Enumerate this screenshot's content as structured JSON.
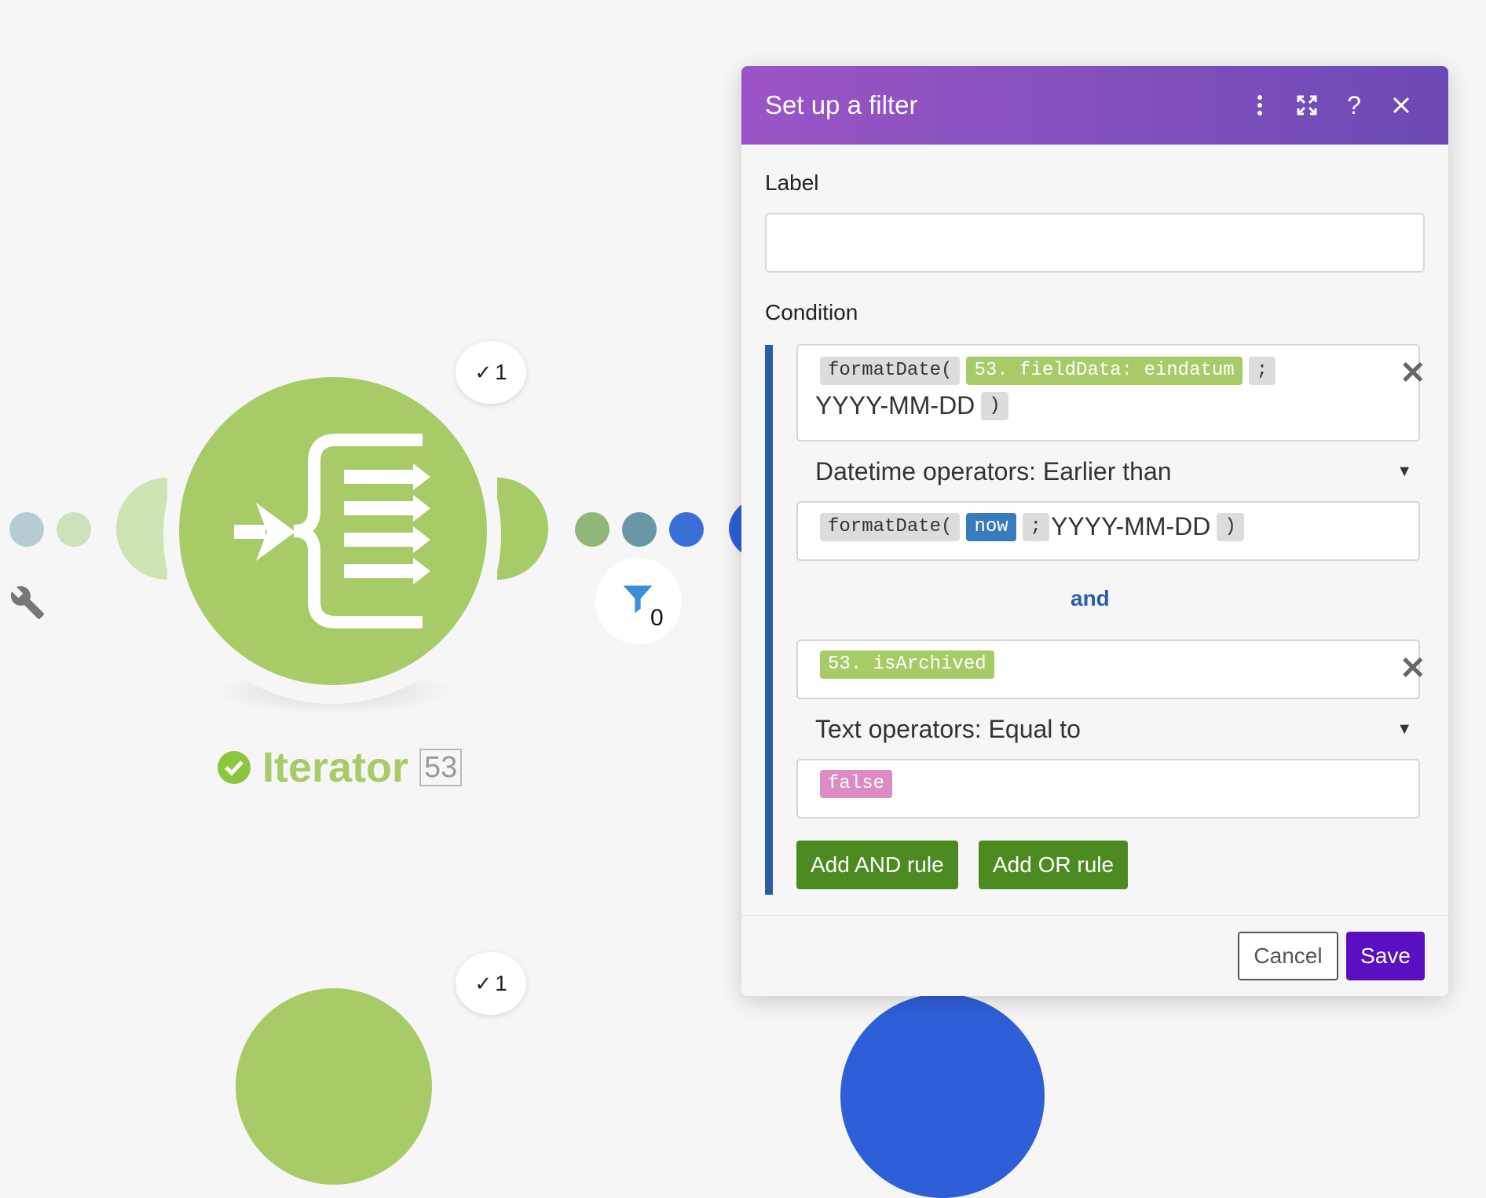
{
  "canvas": {
    "top_badge_count": "1",
    "bottom_badge_count": "1",
    "module_name": "Iterator",
    "module_id": "53",
    "filter_count": "0",
    "colors": {
      "module_green": "#a6cb67",
      "link_blue": "#2f5fd8"
    }
  },
  "dialog": {
    "title": "Set up a filter",
    "header_icons": [
      "more-vertical-icon",
      "expand-icon",
      "help-icon",
      "close-icon"
    ],
    "label_caption": "Label",
    "label_value": "",
    "condition_caption": "Condition",
    "rule1": {
      "left": {
        "fn": "formatDate(",
        "var": "53. fieldData: eindatum",
        "sep": ";",
        "format": "YYYY-MM-DD",
        "close": ")"
      },
      "operator": "Datetime operators: Earlier than",
      "right": {
        "fn": "formatDate(",
        "var": "now",
        "sep": ";",
        "format": "YYYY-MM-DD",
        "close": ")"
      }
    },
    "and_label": "and",
    "rule2": {
      "left": {
        "var": "53. isArchived"
      },
      "operator": "Text operators: Equal to",
      "right": {
        "value": "false"
      }
    },
    "add_and_label": "Add AND rule",
    "add_or_label": "Add OR rule",
    "cancel_label": "Cancel",
    "save_label": "Save",
    "colors": {
      "header_start": "#9b54c7",
      "header_end": "#6c4ab6",
      "save": "#5b0fc2",
      "rule_button": "#4d8b22"
    }
  }
}
